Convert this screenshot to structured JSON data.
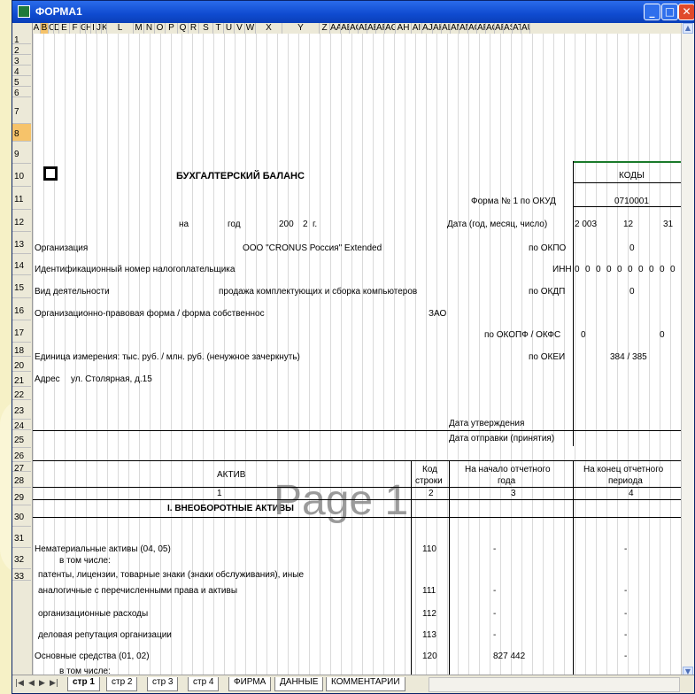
{
  "window": {
    "title": "ФОРМА1",
    "minimize": "_",
    "maximize": "□",
    "close": "✕"
  },
  "columns": [
    "A",
    "B",
    "C",
    "D",
    "E",
    "F",
    "G",
    "H",
    "I",
    "J",
    "K",
    "L",
    "M",
    "N",
    "O",
    "P",
    "Q",
    "R",
    "S",
    "T",
    "U",
    "V",
    "W",
    "X",
    "Y",
    "Z",
    "AA",
    "AB",
    "AC",
    "AD",
    "AE",
    "AF",
    "AG",
    "AH",
    "AI",
    "AJ",
    "AK",
    "AL",
    "AM",
    "AN",
    "AO",
    "AP",
    "AQ",
    "AR",
    "AS",
    "AT",
    "AU"
  ],
  "rows": [
    "1",
    "2",
    "3",
    "4",
    "5",
    "6",
    "7",
    "8",
    "9",
    "10",
    "11",
    "12",
    "13",
    "14",
    "15",
    "16",
    "17",
    "18",
    "20",
    "21",
    "22",
    "23",
    "24",
    "25",
    "26",
    "27",
    "28",
    "29",
    "30",
    "31",
    "32",
    "33"
  ],
  "page_mark": "Page 1",
  "form": {
    "title": "БУХГАЛТЕРСКИЙ  БАЛАНС",
    "codes": "КОДЫ",
    "okud_label": "Форма № 1 по ОКУД",
    "okud_value": "0710001",
    "date_label": "Дата (год, месяц, число)",
    "date_year": "2 003",
    "date_month": "12",
    "date_day": "31",
    "na": "на",
    "god": "год",
    "year_prefix": "200",
    "year_digit": "2",
    "g": "г.",
    "org_label": "Организация",
    "org_value": "ООО \"CRONUS Россия\" Extended",
    "okpo_label": "по ОКПО",
    "okpo_value": "0",
    "inn_text": "Идентификационный номер налогоплательщика",
    "inn_label": "ИНН",
    "inn_digits": [
      "0",
      "0",
      "0",
      "0",
      "0",
      "0",
      "0",
      "0",
      "0",
      "0"
    ],
    "activity_label": "Вид деятельности",
    "activity_value": "продажа комплектующих и сборка компьютеров",
    "okdp_label": "по ОКДП",
    "okdp_value": "0",
    "legal_label": "Организационно-правовая форма / форма собственнос",
    "legal_value": "ЗАО",
    "okopf_label": "по ОКОПФ / ОКФС",
    "okopf_value": "0",
    "okfs_value": "0",
    "unit_label": "Единица измерения: тыс. руб. / млн. руб. (ненужное зачеркнуть)",
    "okei_label": "по ОКЕИ",
    "okei_value": "384 / 385",
    "address_label": "Адрес",
    "address_value": "ул. Столярная, д.15",
    "approval": "Дата утверждения",
    "sent": "Дата отправки (принятия)"
  },
  "table": {
    "h_asset": "АКТИВ",
    "h_code": "Код строки",
    "h_code1": "Код",
    "h_code2": "строки",
    "h_start1": "На начало отчетного",
    "h_start2": "года",
    "h_end1": "На конец отчетного",
    "h_end2": "периода",
    "n1": "1",
    "n2": "2",
    "n3": "3",
    "n4": "4",
    "section": "I. ВНЕОБОРОТНЫЕ АКТИВЫ",
    "rows": [
      {
        "name": "Нематериальные активы (04, 05)",
        "code": "110",
        "start": "-",
        "end": "-"
      },
      {
        "name": "в том числе:",
        "code": "",
        "start": "",
        "end": ""
      },
      {
        "name": "патенты, лицензии, товарные знаки (знаки обслуживания), иные",
        "code": "",
        "start": "",
        "end": ""
      },
      {
        "name": "аналогичные с перечисленными права и активы",
        "code": "111",
        "start": "-",
        "end": "-"
      },
      {
        "name": "организационные расходы",
        "code": "112",
        "start": "-",
        "end": "-"
      },
      {
        "name": "деловая репутация организации",
        "code": "113",
        "start": "-",
        "end": "-"
      },
      {
        "name": "Основные средства (01, 02)",
        "code": "120",
        "start": "827 442",
        "end": "-"
      },
      {
        "name": "в том числе:",
        "code": "",
        "start": "",
        "end": ""
      }
    ]
  },
  "tabs": [
    "стр 1",
    "стр 2",
    "стр 3",
    "стр 4",
    "ФИРМА",
    "ДАННЫЕ",
    "КОММЕНТАРИИ"
  ]
}
